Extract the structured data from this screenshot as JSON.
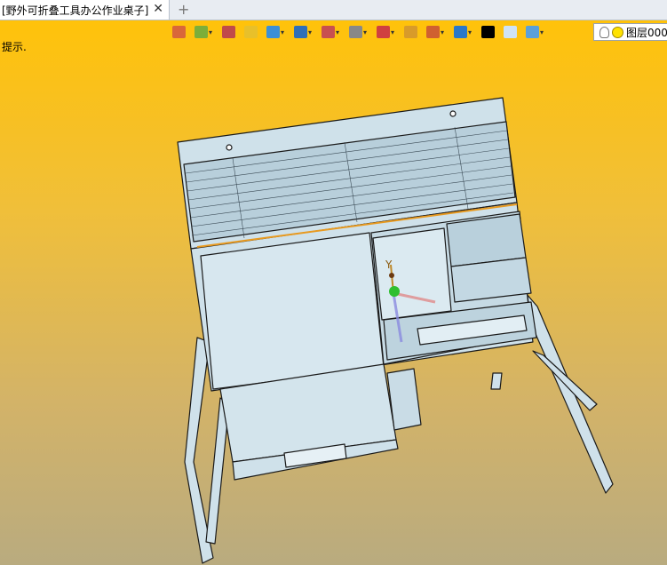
{
  "tab": {
    "title": "[野外可折叠工具办公作业桌子]",
    "close_glyph": "✕",
    "add_glyph": "+"
  },
  "hint": "提示.",
  "toolbar": {
    "items": [
      {
        "name": "import-icon",
        "color": "#d9673a"
      },
      {
        "name": "material-icon",
        "color": "#7cae3a",
        "dropdown": true
      },
      {
        "name": "pen-icon",
        "color": "#c04a4a"
      },
      {
        "name": "box-yellow-icon",
        "color": "#e8c02a"
      },
      {
        "name": "cube-icon",
        "color": "#3b8fd6",
        "dropdown": true
      },
      {
        "name": "components-icon",
        "color": "#2f6fb8",
        "dropdown": true
      },
      {
        "name": "render-icon",
        "color": "#c85050",
        "dropdown": true
      },
      {
        "name": "view-icon",
        "color": "#888888",
        "dropdown": true
      },
      {
        "name": "snap-icon",
        "color": "#d04040",
        "dropdown": true
      },
      {
        "name": "frame-icon",
        "color": "#d89b2a"
      },
      {
        "name": "measure-icon",
        "color": "#d06030",
        "dropdown": true
      },
      {
        "name": "display-icon",
        "color": "#2a78c8",
        "dropdown": true
      },
      {
        "name": "line-color-icon",
        "color": "#000000"
      },
      {
        "name": "fill-color-icon",
        "color": "#cfe3f4"
      },
      {
        "name": "layers-icon",
        "color": "#5aa0d8",
        "dropdown": true
      }
    ],
    "layer_label": "图层000"
  },
  "triad": {
    "y_label": "Y"
  }
}
